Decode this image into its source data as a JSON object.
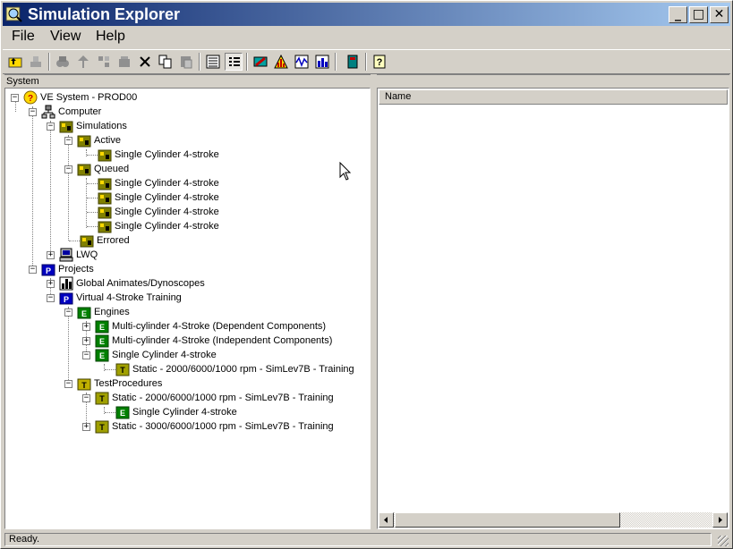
{
  "window": {
    "title": "Simulation Explorer"
  },
  "menu": {
    "file": "File",
    "view": "View",
    "help": "Help"
  },
  "toolbar": {
    "icons": [
      "up-folder-icon",
      "network-icon",
      "binoculars-icon",
      "connect-icon",
      "disconnect-icon",
      "simulation-icon",
      "delete-icon",
      "copy-icon",
      "paste-icon",
      "large-icons-view-icon",
      "details-view-icon",
      "run-icon",
      "warning-chart-icon",
      "signal-icon",
      "bar-chart-icon",
      "book-icon",
      "help-icon"
    ]
  },
  "left_pane": {
    "header": "System"
  },
  "right_pane": {
    "column_name": "Name"
  },
  "tree": {
    "root": "VE System - PROD00",
    "computer": "Computer",
    "simulations": "Simulations",
    "active": "Active",
    "active_item": "Single Cylinder 4-stroke",
    "queued": "Queued",
    "queued_items": [
      "Single Cylinder 4-stroke",
      "Single Cylinder 4-stroke",
      "Single Cylinder 4-stroke",
      "Single Cylinder 4-stroke"
    ],
    "errored": "Errored",
    "lwq": "LWQ",
    "projects": "Projects",
    "global_animates": "Global Animates/Dynoscopes",
    "virtual_training": "Virtual 4-Stroke Training",
    "engines": "Engines",
    "engine_items": [
      "Multi-cylinder 4-Stroke (Dependent Components)",
      "Multi-cylinder 4-Stroke (Independent Components)",
      "Single Cylinder 4-stroke"
    ],
    "engine_test": "Static - 2000/6000/1000 rpm - SimLev7B - Training",
    "test_procedures": "TestProcedures",
    "test_items": [
      "Static - 2000/6000/1000 rpm - SimLev7B - Training",
      "Static - 3000/6000/1000 rpm - SimLev7B - Training"
    ],
    "test_engine": "Single Cylinder 4-stroke"
  },
  "status": {
    "text": "Ready."
  }
}
